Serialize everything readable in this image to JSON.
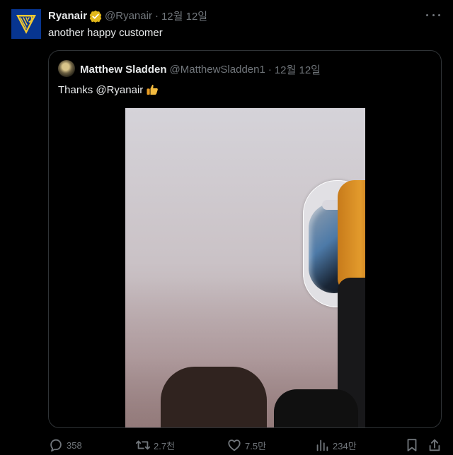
{
  "colors": {
    "background": "#000000",
    "text_primary": "#e7e9ea",
    "text_secondary": "#71767b",
    "border": "#2f3336",
    "verified_badge": "#e2b719",
    "ryanair_blue": "#073590",
    "ryanair_yellow": "#f1c933"
  },
  "post": {
    "author": {
      "name": "Ryanair",
      "handle": "@Ryanair",
      "verified": true,
      "avatar_icon": "ryanair-harp-logo"
    },
    "separator": "·",
    "timestamp": "12월 12일",
    "text": "another happy customer",
    "more_icon": "more-horizontal-icon"
  },
  "quote": {
    "author": {
      "name": "Matthew Sladden",
      "handle": "@MatthewSladden1",
      "avatar_icon": "profile-avatar"
    },
    "separator": "·",
    "timestamp": "12월 12일",
    "text": "Thanks @Ryanair",
    "emoji_icon": "thumbs-up-icon",
    "media": {
      "type": "video-thumbnail",
      "icon": "airplane-window-image"
    }
  },
  "actions": {
    "reply": {
      "icon": "reply-icon",
      "count": "358"
    },
    "repost": {
      "icon": "repost-icon",
      "count": "2.7천"
    },
    "like": {
      "icon": "heart-icon",
      "count": "7.5만"
    },
    "views": {
      "icon": "views-icon",
      "count": "234만"
    },
    "bookmark": {
      "icon": "bookmark-icon"
    },
    "share": {
      "icon": "share-icon"
    }
  }
}
